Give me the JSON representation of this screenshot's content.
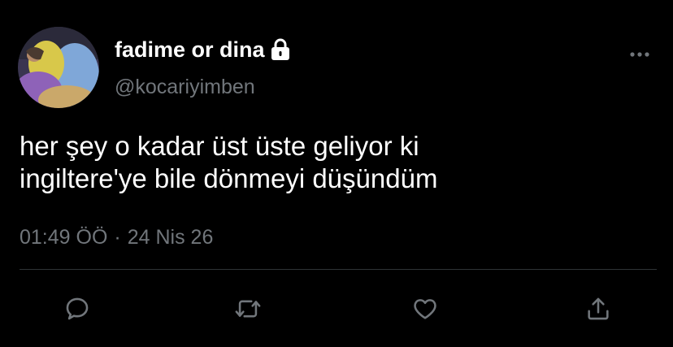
{
  "user": {
    "display_name": "fadime or dina",
    "handle": "@kocariyimben",
    "protected_icon": "lock-icon",
    "avatar": "profile-photo"
  },
  "tweet": {
    "text_lines": [
      "her şey o kadar üst üste geliyor ki",
      "ingiltere'ye bile dönmeyi düşündüm"
    ],
    "time": "01:49 ÖÖ",
    "separator": "·",
    "date": "24 Nis 26"
  },
  "actions": [
    {
      "icon": "reply-icon"
    },
    {
      "icon": "retweet-icon"
    },
    {
      "icon": "like-icon"
    },
    {
      "icon": "share-icon"
    }
  ],
  "menu": {
    "icon": "more-options-icon"
  },
  "colors": {
    "background": "#000000",
    "primary_text": "#ffffff",
    "secondary_text": "#71767b",
    "divider": "#2f3336",
    "icon": "#71767b"
  }
}
